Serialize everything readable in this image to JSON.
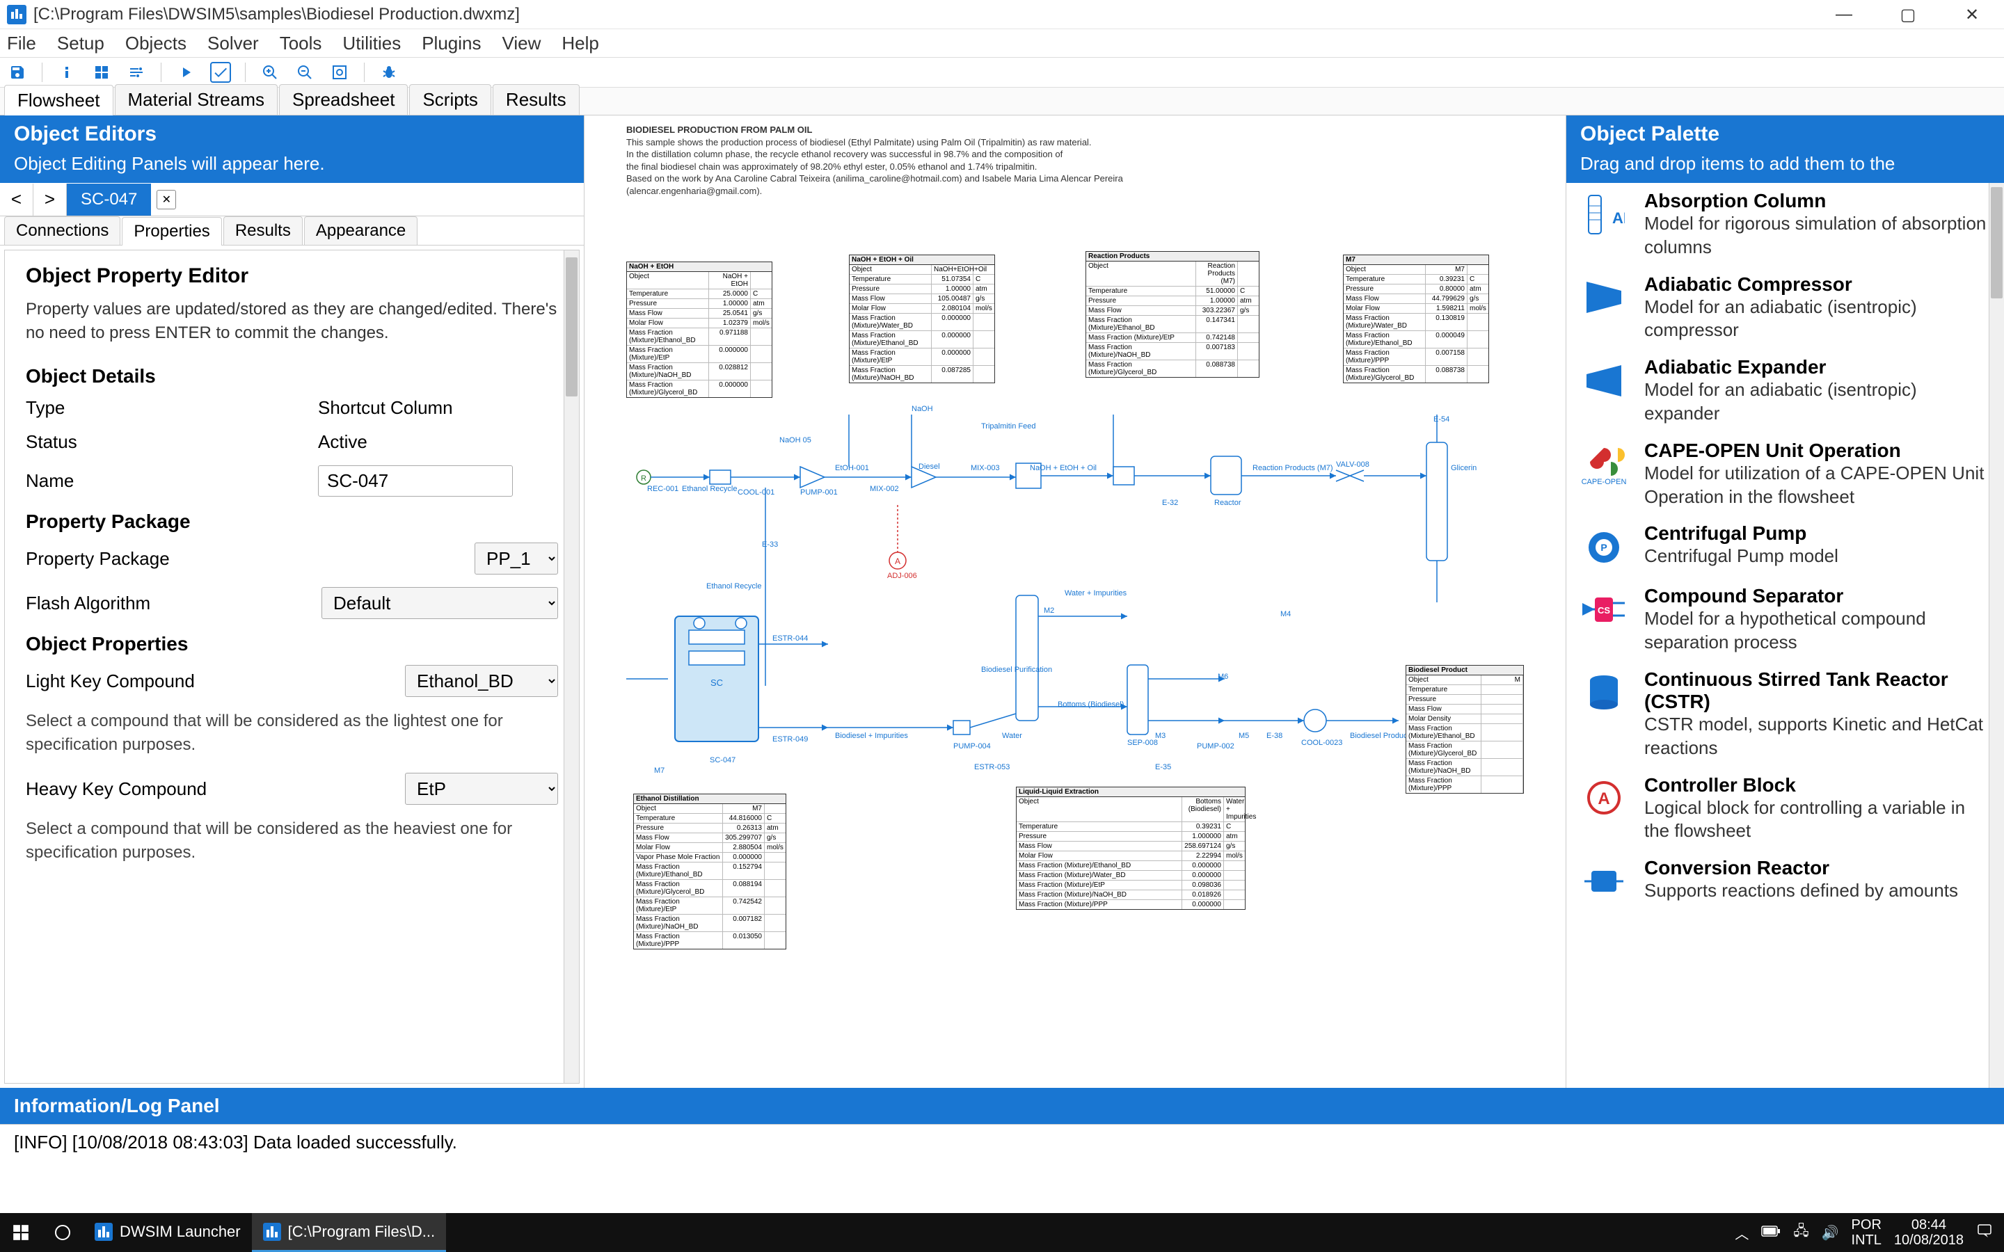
{
  "window": {
    "title": "[C:\\Program Files\\DWSIM5\\samples\\Biodiesel Production.dwxmz]"
  },
  "menu": [
    "File",
    "Setup",
    "Objects",
    "Solver",
    "Tools",
    "Utilities",
    "Plugins",
    "View",
    "Help"
  ],
  "main_tabs": [
    "Flowsheet",
    "Material Streams",
    "Spreadsheet",
    "Scripts",
    "Results"
  ],
  "main_tab_active": 0,
  "left": {
    "header": "Object Editors",
    "sub": "Object Editing Panels will appear here.",
    "nav_tab": "SC-047",
    "sub_tabs": [
      "Connections",
      "Properties",
      "Results",
      "Appearance"
    ],
    "sub_tab_active": 1,
    "editor": {
      "heading": "Object Property Editor",
      "desc": "Property values are updated/stored as they are changed/edited. There's no need to press ENTER to commit the changes.",
      "details_heading": "Object Details",
      "type_label": "Type",
      "type_value": "Shortcut Column",
      "status_label": "Status",
      "status_value": "Active",
      "name_label": "Name",
      "name_value": "SC-047",
      "pp_heading": "Property Package",
      "pp_label": "Property Package",
      "pp_value": "PP_1",
      "flash_label": "Flash Algorithm",
      "flash_value": "Default",
      "op_heading": "Object Properties",
      "lk_label": "Light Key Compound",
      "lk_value": "Ethanol_BD",
      "lk_help": "Select a compound that will be considered as the lightest one for specification purposes.",
      "hk_label": "Heavy Key Compound",
      "hk_value": "EtP",
      "hk_help": "Select a compound that will be considered as the heaviest one for specification purposes."
    }
  },
  "right": {
    "header": "Object Palette",
    "sub": "Drag and drop items to add them to the",
    "items": [
      {
        "title": "Absorption Column",
        "desc": "Model for rigorous simulation of absorption columns"
      },
      {
        "title": "Adiabatic Compressor",
        "desc": "Model for an adiabatic (isentropic) compressor"
      },
      {
        "title": "Adiabatic Expander",
        "desc": "Model for an adiabatic (isentropic) expander"
      },
      {
        "title": "CAPE-OPEN Unit Operation",
        "desc": "Model for utilization of a CAPE-OPEN Unit Operation in the flowsheet"
      },
      {
        "title": "Centrifugal Pump",
        "desc": "Centrifugal Pump model"
      },
      {
        "title": "Compound Separator",
        "desc": "Model for a hypothetical compound separation process"
      },
      {
        "title": "Continuous Stirred Tank Reactor (CSTR)",
        "desc": "CSTR model, supports Kinetic and HetCat reactions"
      },
      {
        "title": "Controller Block",
        "desc": "Logical block for controlling a variable in the flowsheet"
      },
      {
        "title": "Conversion Reactor",
        "desc": "Supports reactions defined by amounts"
      }
    ]
  },
  "canvas": {
    "desc_title": "BIODIESEL PRODUCTION FROM PALM OIL",
    "desc_lines": [
      "This sample shows the production process of biodiesel (Ethyl Palmitate) using Palm Oil (Tripalmitin) as raw material.",
      "In the distillation column phase, the recycle ethanol recovery was successful in 98.7% and the composition of",
      "the final biodiesel chain was approximately of 98.20% ethyl ester, 0.05% ethanol and 1.74% tripalmitin.",
      "Based on the work by Ana Caroline Cabral Teixeira (anilima_caroline@hotmail.com) and Isabele Maria Lima Alencar Pereira (alencar.engenharia@gmail.com)."
    ],
    "labels": {
      "naoh_etoh": "NaOH + EtOH",
      "naoh_etoh_oil": "NaOH + EtOH + Oil",
      "reaction_products": "Reaction Products",
      "m7": "M7",
      "rec001": "REC-001",
      "ethanol_recycle": "Ethanol Recycle",
      "cool001": "COOL-001",
      "r": "R",
      "etoh001": "EtOH-001",
      "naoh": "NaOH",
      "naoh05": "NaOH 05",
      "tripalmitin_feed": "Tripalmitin Feed",
      "pump001": "PUMP-001",
      "mix002": "MIX-002",
      "diesel": "Diesel",
      "mix003": "MIX-003",
      "naoh_etoh_of": "NaOH + EtOH + Oil",
      "reactor": "Reactor",
      "reaction_products_lbl": "Reaction Products (M7)",
      "valv008": "VALV-008",
      "glicerin": "Glicerin",
      "e32": "E-32",
      "e54": "E-54",
      "e33": "E-33",
      "adj006": "ADJ-006",
      "a": "A",
      "ethanol_recycle2": "Ethanol Recycle",
      "sc": "SC",
      "sc047": "SC-047",
      "estr044": "ESTR-044",
      "estr049": "ESTR-049",
      "biodiesel_impurities": "Biodiesel + Impurities",
      "m2": "M2",
      "water_impurities": "Water + Impurities",
      "bottoms_biodiesel": "Bottoms (Biodiesel)",
      "biodiesel_purification": "Biodiesel Purification",
      "sep008": "SEP-008",
      "m4": "M4",
      "water": "Water",
      "pump004": "PUMP-004",
      "m3": "M3",
      "pump002": "PUMP-002",
      "m5": "M5",
      "m6": "M6",
      "cool0023": "COOL-0023",
      "e38": "E-38",
      "biodiesel_product": "Biodiesel Product",
      "estr053": "ESTR-053",
      "e35": "E-35",
      "m7_2": "M7",
      "ethanol_distillation": "Ethanol Distillation",
      "liquid_liquid_extraction": "Liquid-Liquid Extraction"
    }
  },
  "log": {
    "header": "Information/Log Panel",
    "entry": "[INFO] [10/08/2018 08:43:03] Data loaded successfully."
  },
  "taskbar": {
    "items": [
      "DWSIM Launcher",
      "[C:\\Program Files\\D..."
    ],
    "lang": "POR",
    "kbd": "INTL",
    "time": "08:44",
    "date": "10/08/2018"
  }
}
